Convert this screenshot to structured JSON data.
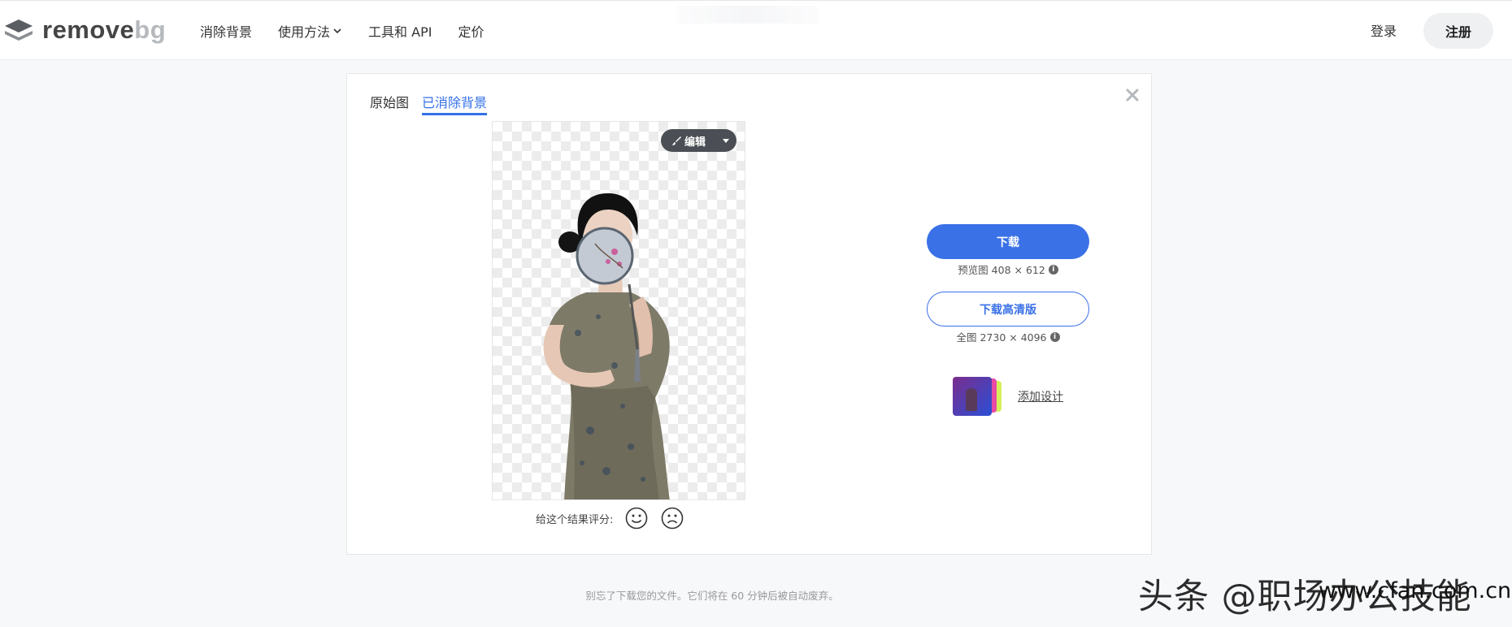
{
  "header": {
    "logo_text": "remove",
    "logo_text_accent": "bg",
    "nav": [
      "消除背景",
      "使用方法",
      "工具和 API",
      "定价"
    ],
    "login_label": "登录",
    "signup_label": "注册"
  },
  "tabs": {
    "original": "原始图",
    "removed": "已消除背景"
  },
  "edit": {
    "label": "编辑"
  },
  "rating": {
    "prompt": "给这个结果评分:"
  },
  "download": {
    "label": "下载",
    "info": "预览图 408 × 612",
    "hd_label": "下载高清版",
    "hd_info": "全图 2730 × 4096"
  },
  "design": {
    "link": "添加设计"
  },
  "footer": {
    "note": "别忘了下载您的文件。它们将在 60 分钟后被自动废弃。"
  },
  "watermark": {
    "text": "头条 @职场办公技能",
    "site": "www.cfan.com.cn"
  },
  "colors": {
    "accent": "#3a71e7",
    "page_bg": "#f7f8fa"
  }
}
